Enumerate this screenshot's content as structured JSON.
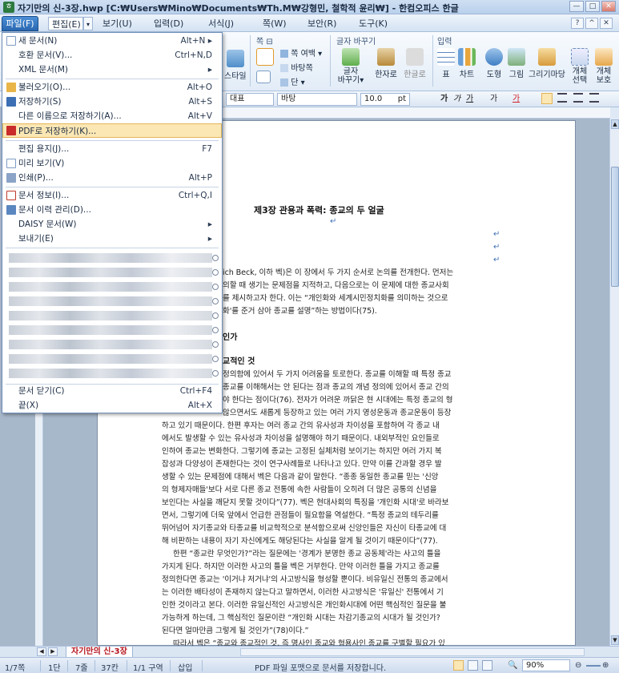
{
  "window": {
    "title": "자기만의 신-3장.hwp [C:₩Users₩Mino₩Documents₩Th.M₩강형민, 철학적 윤리₩] - 한컴오피스 한글",
    "buttons": [
      "—",
      "□",
      "✕"
    ]
  },
  "menubar": {
    "items": [
      "파일(F)",
      "편집(E)",
      "보기(U)",
      "입력(D)",
      "서식(J)",
      "쪽(W)",
      "보안(R)",
      "도구(K)"
    ],
    "drop": "▾",
    "help": [
      "?",
      "^",
      "✕"
    ]
  },
  "ribbon": {
    "group_page": "쪽 ⊟",
    "group_char": "글자 바꾸기",
    "group_input": "입력",
    "style": "스타일",
    "page_margin": "쪽 여백 ▾",
    "background": "바탕쪽",
    "column": "단 ▾",
    "char_change": "글자\n바꾸기▾",
    "hanja": "한자로",
    "hangul": "한글로",
    "table": "표",
    "chart": "차트",
    "shape": "도형",
    "picture": "그림",
    "grimgirimadang": "그리기마당",
    "object_select": "개체\n선택",
    "object_protect": "개체\n보호"
  },
  "formatbar": {
    "style_value": "대표",
    "font_value": "바탕",
    "size_value": "10.0",
    "unit": "pt",
    "bold": "가",
    "italic": "가",
    "underline": "가",
    "strike": "가",
    "color": "가"
  },
  "file_menu": {
    "items": [
      {
        "label": "새 문서(N)",
        "shortcut": "Alt+N ▸"
      },
      {
        "label": "호환 문서(V)...",
        "shortcut": "Ctrl+N,D"
      },
      {
        "label": "XML 문서(M)",
        "shortcut": "▸"
      },
      {
        "label": "불러오기(O)...",
        "shortcut": "Alt+O"
      },
      {
        "label": "저장하기(S)",
        "shortcut": "Alt+S"
      },
      {
        "label": "다른 이름으로 저장하기(A)...",
        "shortcut": "Alt+V"
      },
      {
        "label": "PDF로 저장하기(K)...",
        "shortcut": ""
      },
      {
        "label": "편집 용지(J)...",
        "shortcut": "F7"
      },
      {
        "label": "미리 보기(V)",
        "shortcut": ""
      },
      {
        "label": "인쇄(P)...",
        "shortcut": "Alt+P"
      },
      {
        "label": "문서 정보(I)...",
        "shortcut": "Ctrl+Q,I"
      },
      {
        "label": "문서 이력 관리(D)...",
        "shortcut": ""
      },
      {
        "label": "DAISY 문서(W)",
        "shortcut": "▸"
      },
      {
        "label": "보내기(E)",
        "shortcut": "▸"
      },
      {
        "label": "문서 닫기(C)",
        "shortcut": "Ctrl+F4"
      },
      {
        "label": "끝(X)",
        "shortcut": "Alt+X"
      }
    ],
    "highlighted": "PDF로 저장하기(K)..."
  },
  "document": {
    "title": "제3장 관용과 폭력: 종교의 두 얼굴",
    "lines": [
      "ich Beck, 이하 벡)은 이 장에서 두 가지 순서로 논의를 전개한다. 먼저는",
      "의할 때 생기는 문제점을 지적하고, 다음으로는 이 문제에 대한 종교사회",
      "를 제시하고자 한다. 이는 “개인화와 세계시민정치화를 의미하는 것으로",
      "화'를 준거 삼아 종교를 설명”하는 방법이다(75).",
      "인가",
      "교적인 것",
      "정의함에 있어서 두 가지 어려움을 토로한다. 종교를 이해할 때 특정 종교",
      "종교를 이해해서는 안 된다는 점과 종교의 개념 정의에 있어서 종교 간의",
      "야 한다는 점이다(76). 전자가 어려운 까닭은 현 시대에는 특정 종교의 형",
      "않으면서도 새롭게 등장하고 있는 여러 가지 영성운동과 종교운동이 등장",
      "하고 있기 때문이다. 한편 후자는 여러 종교 간의 유사성과 차이성을 포함하여 각 종교 내",
      "에서도 발생할 수 있는 유사성과 차이성을 설명해야 하기 때문이다. 내외부적인 요인들로",
      "인하여 종교는 변화한다. 그렇기에 종교는 고정된 실체처럼 보이기는 하지만 여러 가지 복",
      "잡성과 다양성이 존재한다는 것이 연구사례들로 나타나고 있다. 만약 이를 간과할 경우 발",
      "생할 수 있는 문제점에 대해서 벡은 다음과 같이 말한다. “종종 동일한 종교를 믿는 '신앙",
      "의 형제자매들'보다 서로 다른 종교 전통에 속한 사람들이 오히려 더 많은 공통의 신념을",
      "보인다는 사실을 깨닫지 못할 것이다”(77). 벡은 현대사회의 특징을 '개인화 시대'로 바라보",
      "면서, 그렇기에 더욱 앞에서 언급한 관점들이 필요함을 역설한다. “특정 종교의 테두리를",
      "뛰어넘어 자기종교와 타종교를 비교학적으로 분석함으로써 신앙인들은 자신이 타종교에 대",
      "해 비판하는 내용이 자기 자신에게도 해당된다는 사실을 알게 될 것이기 때문이다”(77).",
      "한편 “종교란 무엇인가?”라는 질문에는 '경계가 분명한 종교 공동체'라는 사고의 틀을",
      "가지게 된다. 하지만 이러한 사고의 틀을 벡은 거부한다. 만약 이러한 틀을 가지고 종교를",
      "정의한다면 종교는 '이거냐 저거냐'의 사고방식을 형성할 뿐이다. 비유일신 전통의 종교에서",
      "는 이러한 배타성이 존재하지 않는다고 말하면서, 이러한 사고방식은 '유일신' 전통에서 기",
      "인한 것이라고 본다. 이러한 유일신적인 사고방식은 개인화시대에 어떤 핵심적인 질문을 불",
      "가능하게 하는데, 그 핵심적인 질문이란 “개인화 시대는 차감기종교의 시대가 될 것인가?",
      "된다면 얼마만큼 그렇게 될 것인가”(78)이다.”",
      "따라서 벡은 “종교와 종교적인 것, 즉 명사인 종교와 형용사인 종교를 구별할 필요가 있",
      "다”(78)고 말한다. 벡이 말하는 패러부석이 '종교'는 '이거냐 저거냐'의 종교이며 이에 대해"
    ],
    "para_mark": "↵"
  },
  "tabs": {
    "doc_tab": "자기만의 신-3장"
  },
  "status": {
    "page": "1/7쪽",
    "column": "1단",
    "line": "7줄",
    "char": "37칸",
    "section": "1/1 구역",
    "mode": "삽입",
    "message": "PDF 파일 포맷으로 문서를 저장합니다.",
    "zoom": "90%"
  }
}
